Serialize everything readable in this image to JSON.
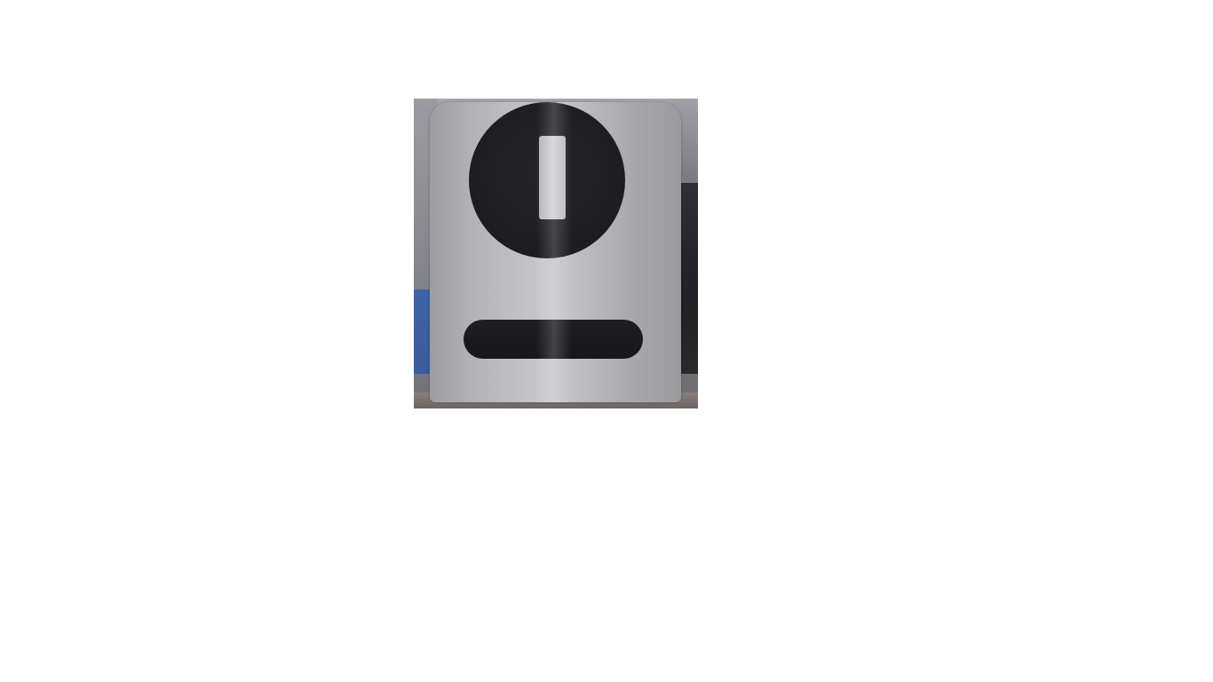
{
  "image": {
    "alt": "",
    "symbols": [
      "black-circle-with-vertical-slot",
      "black-horizontal-bar"
    ],
    "colors": {
      "card": "#b9b9be",
      "symbols": "#1c1c21",
      "background_blue": "#3f63a8",
      "page": "#ffffff"
    }
  }
}
